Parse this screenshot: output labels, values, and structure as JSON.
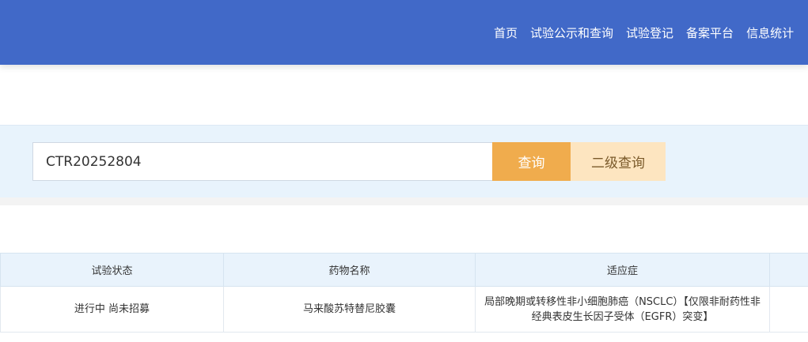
{
  "header": {
    "nav": [
      "首页",
      "试验公示和查询",
      "试验登记",
      "备案平台",
      "信息统计"
    ]
  },
  "search": {
    "value": "CTR20252804",
    "query_label": "查询",
    "advanced_label": "二级查询"
  },
  "table": {
    "headers": [
      "试验状态",
      "药物名称",
      "适应症"
    ],
    "rows": [
      [
        "进行中 尚未招募",
        "马来酸苏特替尼胶囊",
        "局部晚期或转移性非小细胞肺癌（NSCLC）【仅限非耐药性非经典表皮生长因子受体（EGFR）突变】"
      ]
    ]
  },
  "colors": {
    "header_bg": "#4169c8",
    "query_button": "#f0ac4d",
    "advanced_button": "#fde5c0",
    "search_band": "#e8f3fc"
  }
}
